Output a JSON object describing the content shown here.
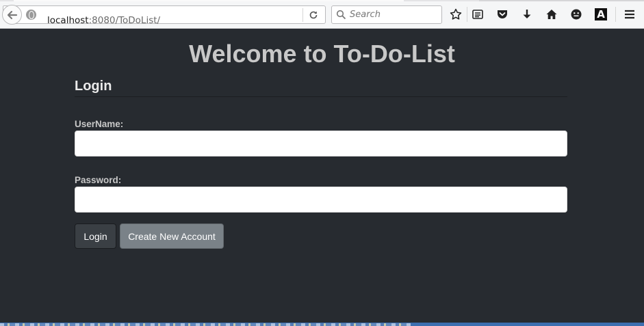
{
  "browser": {
    "url_host": "localhost",
    "url_rest": ":8080/ToDoList/",
    "search_placeholder": "Search",
    "icons": [
      "back-arrow-icon",
      "globe-icon",
      "reload-icon",
      "search-icon",
      "bookmark-star-icon",
      "reading-list-icon",
      "pocket-icon",
      "download-icon",
      "home-icon",
      "emoji-icon",
      "a-icon",
      "menu-icon"
    ]
  },
  "page": {
    "title": "Welcome to To-Do-List",
    "section_title": "Login",
    "username_label": "UserName:",
    "username_value": "",
    "password_label": "Password:",
    "password_value": "",
    "login_button": "Login",
    "create_button": "Create New Account"
  },
  "colors": {
    "background": "#272b30",
    "title_text": "#c8c8c8",
    "login_button": "#3a3f44",
    "create_button": "#7a8288"
  }
}
